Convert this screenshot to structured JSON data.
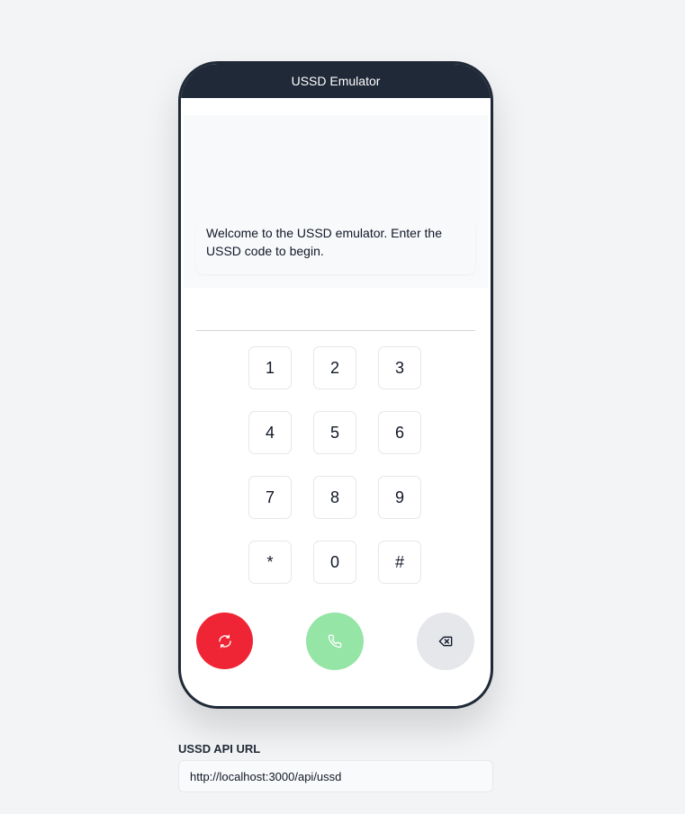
{
  "phone": {
    "header_title": "USSD Emulator",
    "welcome_message": "Welcome to the USSD emulator. Enter the USSD code to begin."
  },
  "keypad": {
    "keys": [
      "1",
      "2",
      "3",
      "4",
      "5",
      "6",
      "7",
      "8",
      "9",
      "*",
      "0",
      "#"
    ]
  },
  "actions": {
    "reset_icon": "refresh-icon",
    "call_icon": "phone-icon",
    "backspace_icon": "backspace-icon"
  },
  "api": {
    "label": "USSD API URL",
    "url": "http://localhost:3000/api/ussd"
  },
  "colors": {
    "phone_frame": "#1f2937",
    "reset_button": "#ef2535",
    "call_button": "#95e5a6",
    "backspace_button": "#e5e7eb"
  }
}
